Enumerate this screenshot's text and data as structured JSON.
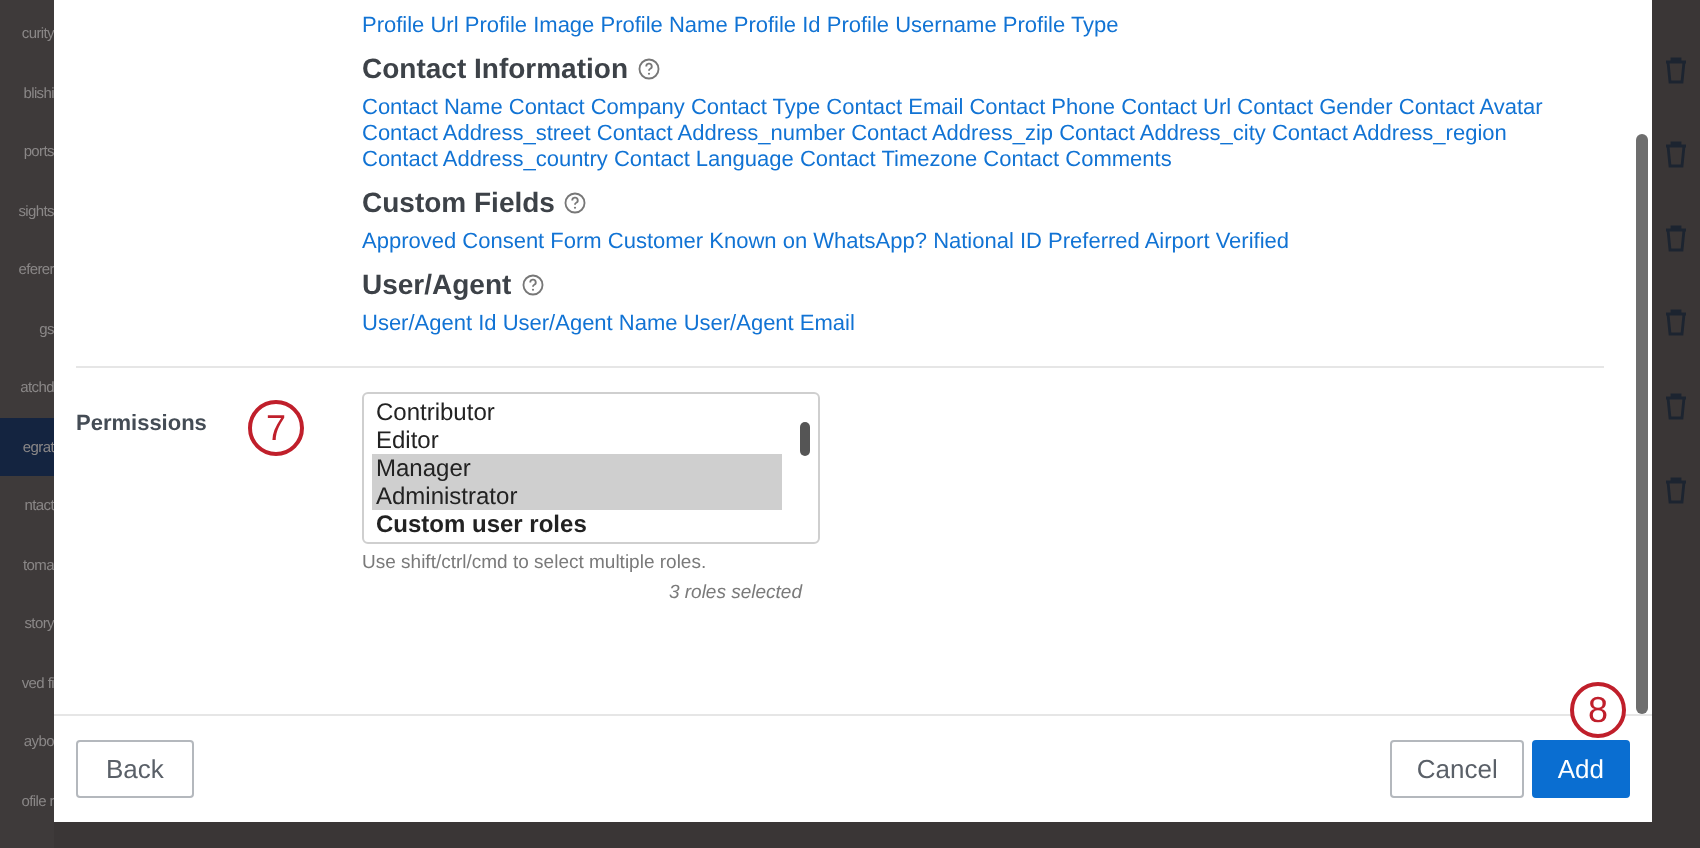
{
  "sidebar": {
    "items": [
      {
        "label": "curity",
        "selected": false
      },
      {
        "label": "blishi",
        "selected": false
      },
      {
        "label": "ports",
        "selected": false
      },
      {
        "label": "sights",
        "selected": false
      },
      {
        "label": "eferer",
        "selected": false
      },
      {
        "label": "gs",
        "selected": false
      },
      {
        "label": "atchd",
        "selected": false
      },
      {
        "label": "egrat",
        "selected": true
      },
      {
        "label": "ntact",
        "selected": false
      },
      {
        "label": "toma",
        "selected": false
      },
      {
        "label": "story",
        "selected": false
      },
      {
        "label": "ved fi",
        "selected": false
      },
      {
        "label": "aybo",
        "selected": false
      },
      {
        "label": "ofile r",
        "selected": false
      }
    ]
  },
  "dialog": {
    "field_groups": [
      {
        "fields": [
          "Profile Url",
          "Profile Image",
          "Profile Name",
          "Profile Id",
          "Profile Username",
          "Profile Type"
        ]
      },
      {
        "title": "Contact Information",
        "fields": [
          "Contact Name",
          "Contact Company",
          "Contact Type",
          "Contact Email",
          "Contact Phone",
          "Contact Url",
          "Contact Gender",
          "Contact Avatar",
          "Contact Address_street",
          "Contact Address_number",
          "Contact Address_zip",
          "Contact Address_city",
          "Contact Address_region",
          "Contact Address_country",
          "Contact Language",
          "Contact Timezone",
          "Contact Comments"
        ]
      },
      {
        "title": "Custom Fields",
        "fields": [
          "Approved Consent Form",
          "Customer Known on WhatsApp?",
          "National ID",
          "Preferred Airport",
          "Verified"
        ]
      },
      {
        "title": "User/Agent",
        "fields": [
          "User/Agent Id",
          "User/Agent Name",
          "User/Agent Email"
        ]
      }
    ],
    "permissions": {
      "label": "Permissions",
      "callout": "7",
      "roles": [
        {
          "label": "Contributor",
          "selected": false
        },
        {
          "label": "Editor",
          "selected": false
        },
        {
          "label": "Manager",
          "selected": true
        },
        {
          "label": "Administrator",
          "selected": true
        },
        {
          "label": "Custom user roles",
          "selected": false,
          "kind": "group"
        }
      ],
      "hint": "Use shift/ctrl/cmd to select multiple roles.",
      "count": "3 roles selected"
    },
    "footer": {
      "back": "Back",
      "cancel": "Cancel",
      "add": "Add",
      "callout": "8"
    }
  }
}
